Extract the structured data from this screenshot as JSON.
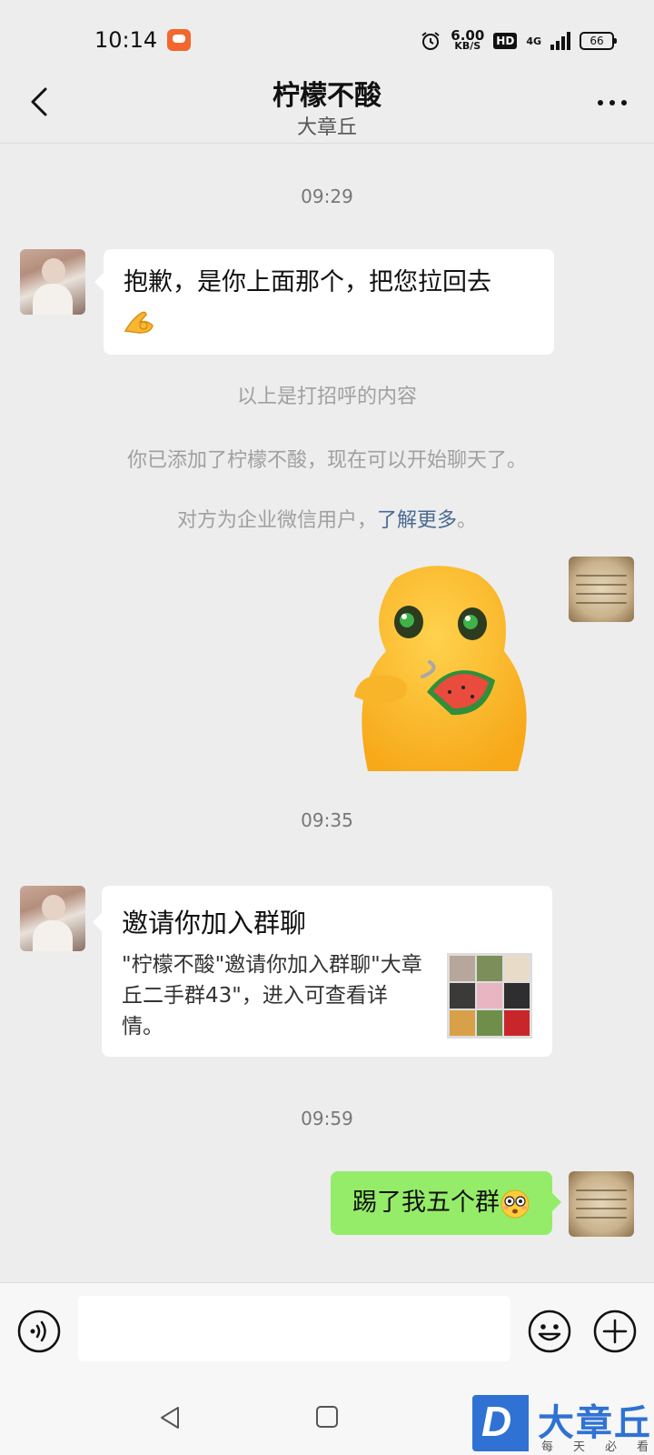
{
  "status_bar": {
    "time": "10:14",
    "speed_value": "6.00",
    "speed_unit": "KB/S",
    "hd": "HD",
    "network": "4G",
    "battery": "66"
  },
  "header": {
    "title": "柠檬不酸",
    "subtitle": "大章丘"
  },
  "messages": {
    "time_1": "09:29",
    "msg_1_text": "抱歉，是你上面那个，把您拉回去",
    "note_1": "以上是打招呼的内容",
    "note_2": "你已添加了柠檬不酸，现在可以开始聊天了。",
    "note_3_prefix": "对方为企业微信用户，",
    "note_3_link": "了解更多",
    "note_3_suffix": "。",
    "time_2": "09:35",
    "invite_title": "邀请你加入群聊",
    "invite_desc": "\"柠檬不酸\"邀请你加入群聊\"大章丘二手群43\"，进入可查看详情。",
    "time_3": "09:59",
    "msg_2_text": "踢了我五个群"
  },
  "input_bar": {
    "placeholder": ""
  },
  "watermark": {
    "logo_letter": "D",
    "name": "大章丘",
    "slogan": "每天必看"
  },
  "colors": {
    "background": "#ededed",
    "bubble_self": "#95ec69",
    "bubble_other": "#ffffff",
    "link": "#4a6a94",
    "brand": "#2f72d3"
  }
}
